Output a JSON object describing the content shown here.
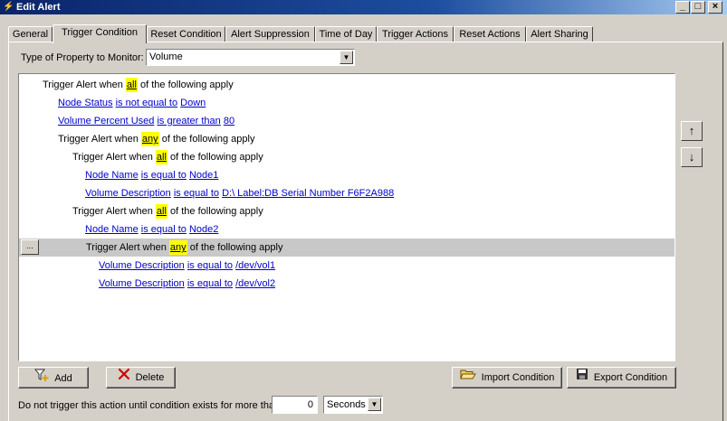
{
  "window": {
    "title": "Edit Alert",
    "minimize": "_",
    "maximize": "□",
    "close": "×"
  },
  "tabs": [
    {
      "label": "General"
    },
    {
      "label": "Trigger Condition",
      "active": true
    },
    {
      "label": "Reset Condition"
    },
    {
      "label": "Alert Suppression"
    },
    {
      "label": "Time of Day"
    },
    {
      "label": "Trigger Actions"
    },
    {
      "label": "Reset Actions"
    },
    {
      "label": "Alert Sharing"
    }
  ],
  "property": {
    "label": "Type of Property to Monitor:",
    "value": "Volume"
  },
  "conditions": {
    "r0": {
      "pre": "Trigger Alert when ",
      "kw": "all",
      "post": " of the following apply"
    },
    "r1": {
      "field": "Node Status",
      "op": "is not equal to",
      "value": "Down"
    },
    "r2": {
      "field": "Volume Percent Used",
      "op": "is greater than",
      "value": "80"
    },
    "r3": {
      "pre": "Trigger Alert when ",
      "kw": "any",
      "post": " of the following apply"
    },
    "r4": {
      "pre": "Trigger Alert when ",
      "kw": "all",
      "post": " of the following apply"
    },
    "r5": {
      "field": "Node Name",
      "op": "is equal to",
      "value": "Node1"
    },
    "r6": {
      "field": "Volume Description",
      "op": "is equal to",
      "value": "D:\\ Label:DB Serial Number F6F2A988"
    },
    "r7": {
      "pre": "Trigger Alert when ",
      "kw": "all",
      "post": " of the following apply"
    },
    "r8": {
      "field": "Node Name",
      "op": "is equal to",
      "value": "Node2"
    },
    "r9": {
      "pre": "Trigger Alert when ",
      "kw": "any",
      "post": " of the following apply",
      "selected": true,
      "button": "..."
    },
    "r10": {
      "field": "Volume Description",
      "op": "is equal to",
      "value": "/dev/vol1"
    },
    "r11": {
      "field": "Volume Description",
      "op": "is equal to",
      "value": "/dev/vol2"
    }
  },
  "move": {
    "up": "↑",
    "down": "↓"
  },
  "buttons": {
    "add": "Add",
    "delete": "Delete",
    "import": "Import Condition",
    "export": "Export Condition"
  },
  "footer": {
    "label": "Do not trigger this action until condition exists for more than",
    "value": "0",
    "unit": "Seconds"
  },
  "colors": {
    "highlight": "#ffff00",
    "link": "#0000cc",
    "selected_row": "#c8c8c8",
    "titlebar": "#0a246a"
  }
}
